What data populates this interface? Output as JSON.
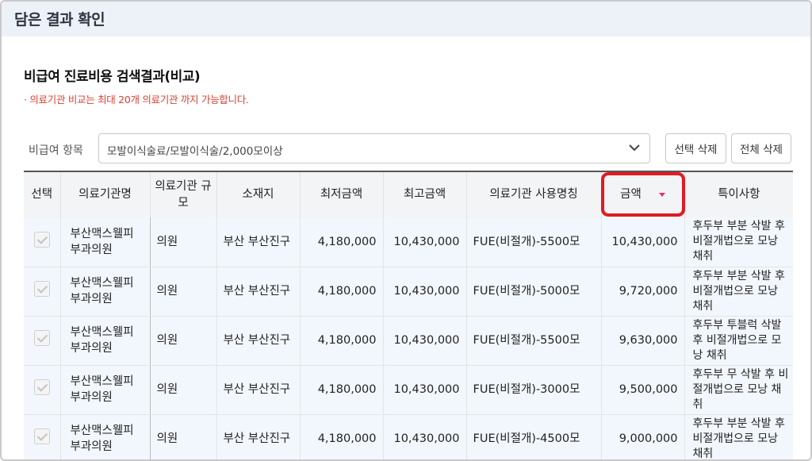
{
  "header": {
    "title": "담은 결과 확인"
  },
  "section": {
    "title": "비급여 진료비용 검색결과(비교)",
    "note": "· 의료기관 비교는 최대 20개 의료기관 까지 가능합니다."
  },
  "filter": {
    "label": "비급여 항목",
    "selected": "모발이식술료/모발이식술/2,000모이상",
    "delete_selected_label": "선택 삭제",
    "delete_all_label": "전체 삭제"
  },
  "table": {
    "headers": {
      "select": "선택",
      "name": "의료기관명",
      "scale": "의료기관 규모",
      "location": "소재지",
      "min": "최저금액",
      "max": "최고금액",
      "term": "의료기관 사용명칭",
      "amount": "금액",
      "note": "특이사항"
    },
    "rows": [
      {
        "name": "부산맥스웰피부과의원",
        "scale": "의원",
        "location": "부산 부산진구",
        "min": "4,180,000",
        "max": "10,430,000",
        "term": "FUE(비절개)-5500모",
        "amount": "10,430,000",
        "note": "후두부 부분 삭발 후 비절개법으로 모낭 채취"
      },
      {
        "name": "부산맥스웰피부과의원",
        "scale": "의원",
        "location": "부산 부산진구",
        "min": "4,180,000",
        "max": "10,430,000",
        "term": "FUE(비절개)-5000모",
        "amount": "9,720,000",
        "note": "후두부 부분 삭발 후 비절개법으로 모낭 채취"
      },
      {
        "name": "부산맥스웰피부과의원",
        "scale": "의원",
        "location": "부산 부산진구",
        "min": "4,180,000",
        "max": "10,430,000",
        "term": "FUE(비절개)-5500모",
        "amount": "9,630,000",
        "note": "후두부 투블럭 삭발 후 비절개법으로 모낭 채취"
      },
      {
        "name": "부산맥스웰피부과의원",
        "scale": "의원",
        "location": "부산 부산진구",
        "min": "4,180,000",
        "max": "10,430,000",
        "term": "FUE(비절개)-3000모",
        "amount": "9,500,000",
        "note": "후두부 무 삭발 후 비절개법으로 모낭 채취"
      },
      {
        "name": "부산맥스웰피부과의원",
        "scale": "의원",
        "location": "부산 부산진구",
        "min": "4,180,000",
        "max": "10,430,000",
        "term": "FUE(비절개)-4500모",
        "amount": "9,000,000",
        "note": "후두부 부분 삭발 후 비절개법으로 모낭 채취"
      }
    ]
  },
  "icons": {
    "dropdown": "chevron-down-icon",
    "sort": "sort-desc-icon",
    "checkbox": "checkbox-checked-icon"
  },
  "colors": {
    "note": "#d94133",
    "highlight": "#e01b23",
    "row_bg": "#f2f7fd",
    "sort": "#e0316b"
  }
}
